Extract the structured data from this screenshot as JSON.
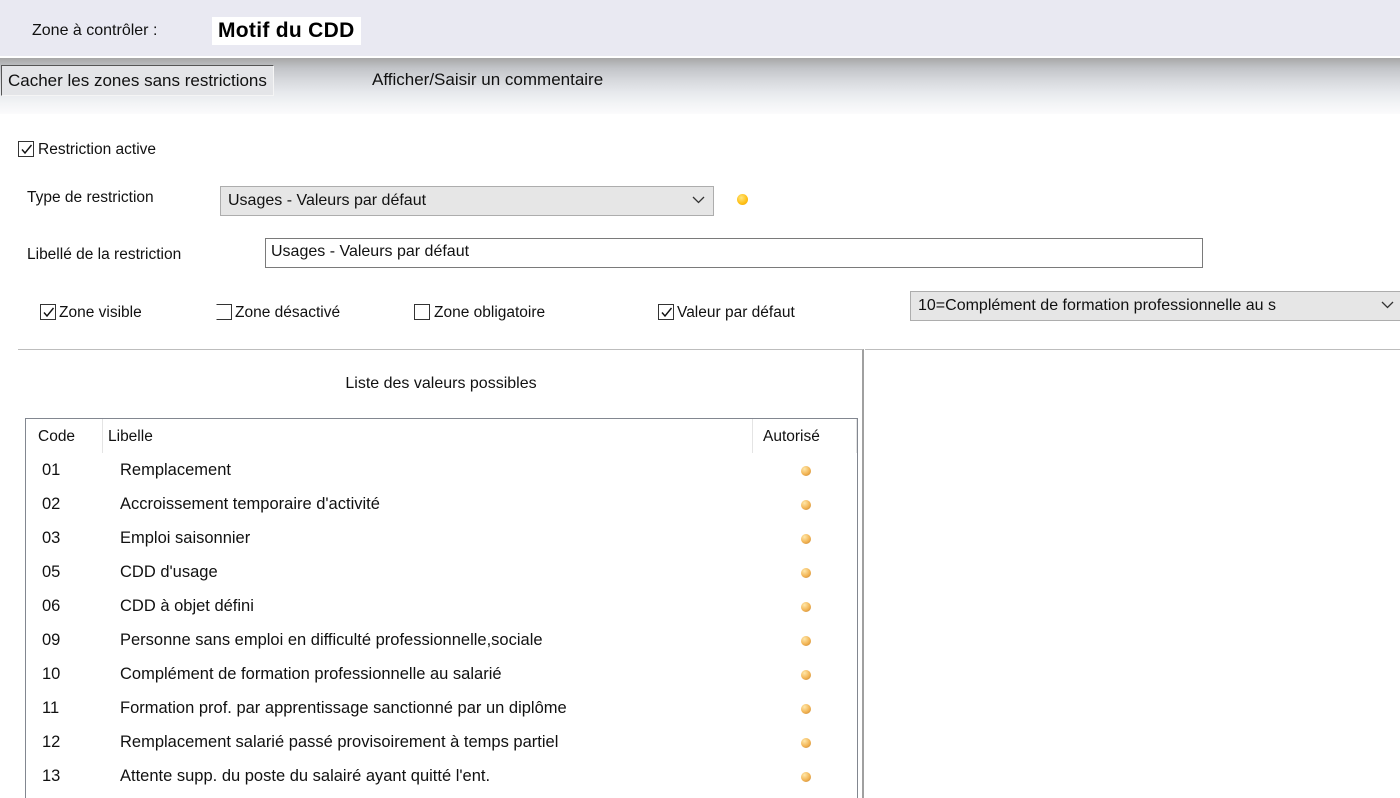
{
  "header": {
    "zone_label": "Zone à contrôler :",
    "zone_value": "Motif du CDD"
  },
  "toolbar": {
    "hide_zones_label": "Cacher les zones sans restrictions",
    "comment_label": "Afficher/Saisir un commentaire"
  },
  "restriction": {
    "active_label": "Restriction active",
    "active_checked": true,
    "type_label": "Type de restriction",
    "type_value": "Usages - Valeurs par défaut",
    "libelle_label": "Libellé de la restriction",
    "libelle_value": "Usages - Valeurs par défaut"
  },
  "options": {
    "zone_visible_label": "Zone visible",
    "zone_visible_checked": true,
    "zone_desactive_label": "Zone désactivé",
    "zone_desactive_checked": false,
    "zone_obligatoire_label": "Zone obligatoire",
    "zone_obligatoire_checked": false,
    "valeur_defaut_label": "Valeur par défaut",
    "valeur_defaut_checked": true,
    "valeur_defaut_value": "10=Complément de formation professionnelle au s"
  },
  "values_list": {
    "title": "Liste des valeurs possibles",
    "columns": [
      "Code",
      "Libelle",
      "Autorisé"
    ],
    "rows": [
      {
        "code": "01",
        "libelle": "Remplacement",
        "autorise": true
      },
      {
        "code": "02",
        "libelle": "Accroissement temporaire d'activité",
        "autorise": true
      },
      {
        "code": "03",
        "libelle": "Emploi saisonnier",
        "autorise": true
      },
      {
        "code": "05",
        "libelle": "CDD d'usage",
        "autorise": true
      },
      {
        "code": "06",
        "libelle": "CDD à objet défini",
        "autorise": true
      },
      {
        "code": "09",
        "libelle": "Personne sans emploi en difficulté professionnelle,sociale",
        "autorise": true
      },
      {
        "code": "10",
        "libelle": "Complément de formation professionnelle au salarié",
        "autorise": true
      },
      {
        "code": "11",
        "libelle": "Formation prof. par apprentissage sanctionné par un diplôme",
        "autorise": true
      },
      {
        "code": "12",
        "libelle": "Remplacement salarié passé provisoirement à temps partiel",
        "autorise": true
      },
      {
        "code": "13",
        "libelle": "Attente supp. du poste du salairé ayant quitté l'ent.",
        "autorise": true
      }
    ]
  },
  "colors": {
    "header_bg": "#e9e9f2",
    "status_dot": "#ffc21a",
    "autorise_dot": "#f2b454"
  },
  "icons": {
    "checkbox_checked": "check-icon",
    "dropdown": "chevron-down-icon",
    "status": "yellow-dot-icon"
  }
}
